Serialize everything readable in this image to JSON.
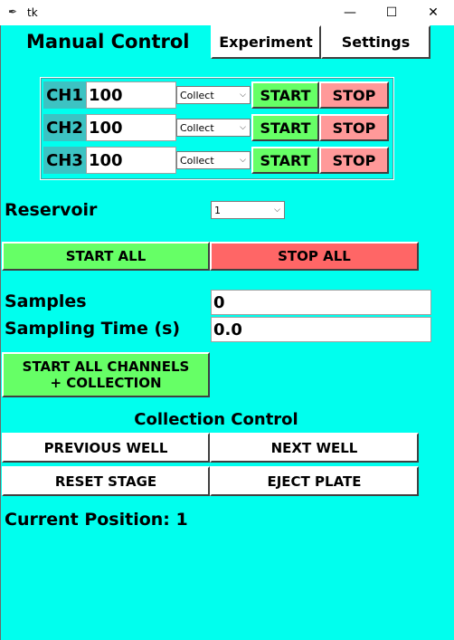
{
  "window": {
    "title": "tk",
    "minimize": "—",
    "maximize": "☐",
    "close": "✕"
  },
  "header": {
    "title": "Manual Control",
    "experiment_label": "Experiment",
    "settings_label": "Settings"
  },
  "channels": [
    {
      "label": "CH1",
      "value": "100",
      "mode": "Collect",
      "start_label": "START",
      "stop_label": "STOP"
    },
    {
      "label": "CH2",
      "value": "100",
      "mode": "Collect",
      "start_label": "START",
      "stop_label": "STOP"
    },
    {
      "label": "CH3",
      "value": "100",
      "mode": "Collect",
      "start_label": "START",
      "stop_label": "STOP"
    }
  ],
  "reservoir": {
    "label": "Reservoir",
    "value": "1"
  },
  "global": {
    "start_all_label": "START ALL",
    "stop_all_label": "STOP ALL"
  },
  "samples": {
    "label": "Samples",
    "value": "0"
  },
  "sampling_time": {
    "label": "Sampling Time (s)",
    "value": "0.0"
  },
  "start_collection": {
    "line1": "START ALL CHANNELS",
    "line2": "+ COLLECTION"
  },
  "collection": {
    "title": "Collection Control",
    "previous_label": "PREVIOUS WELL",
    "next_label": "NEXT WELL",
    "reset_label": "RESET STAGE",
    "eject_label": "EJECT PLATE"
  },
  "position": {
    "text": "Current Position: 1"
  },
  "colors": {
    "background": "#00ffee",
    "green": "#66ff66",
    "red": "#ff6666",
    "pink": "#ff9999",
    "channel_label": "#3cc3c3"
  }
}
